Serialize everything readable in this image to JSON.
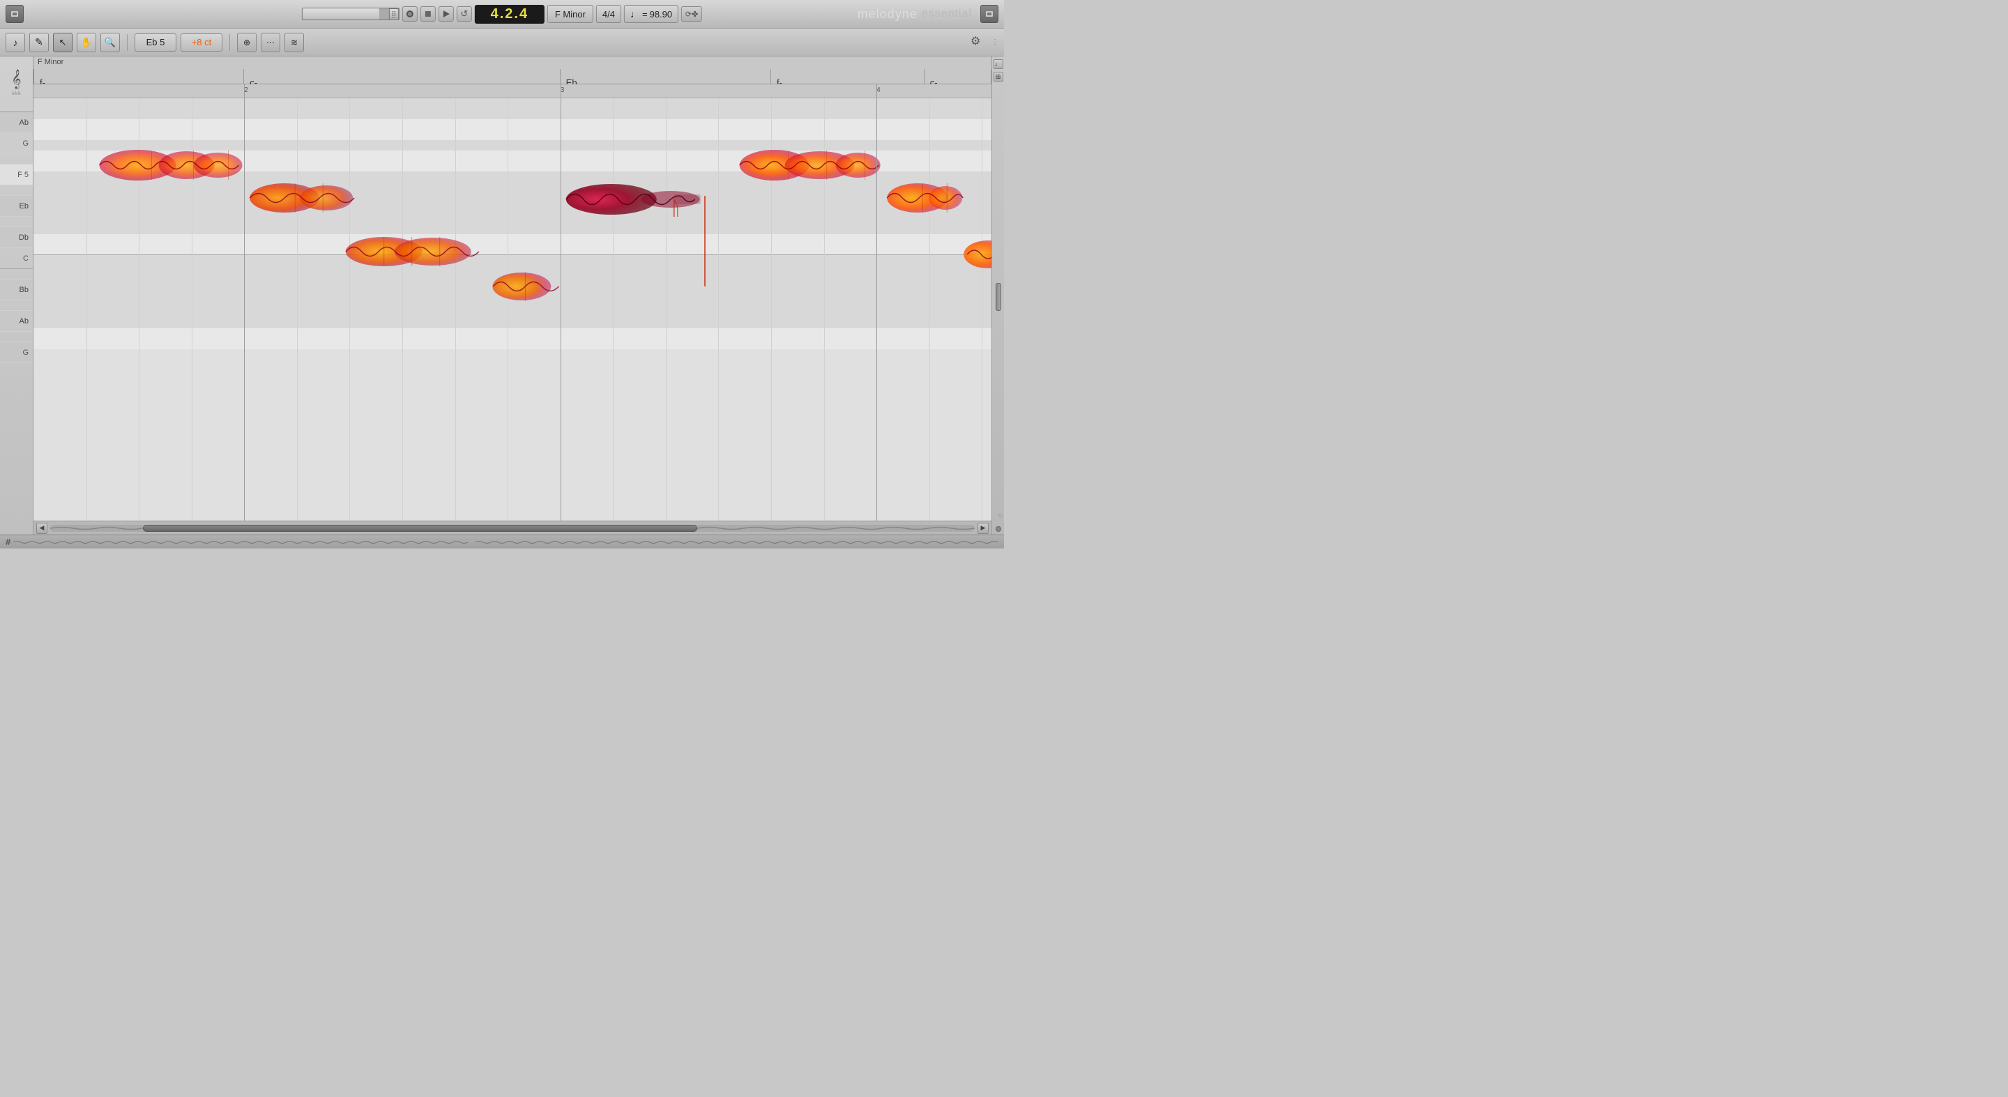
{
  "topbar": {
    "position": "4.2.4",
    "key": "F Minor",
    "time_signature": "4/4",
    "tempo_value": "98.90",
    "branding_main": "melodyne",
    "branding_sub": "essential",
    "transport": {
      "record_label": "●",
      "stop_label": "■",
      "play_label": "▶",
      "loop_label": "↺"
    }
  },
  "toolbar": {
    "pitch_note": "Eb 5",
    "pitch_cents": "+8 ct"
  },
  "chord_header": {
    "key_label": "F Minor",
    "chords": [
      "f-",
      "c-",
      "Eb",
      "f-",
      "c-"
    ]
  },
  "timeline": {
    "markers": [
      "2",
      "3",
      "4"
    ]
  },
  "piano_keys": [
    {
      "note": "Ab",
      "type": "black"
    },
    {
      "note": "",
      "type": "white"
    },
    {
      "note": "G",
      "type": "white"
    },
    {
      "note": "",
      "type": "white"
    },
    {
      "note": "F 5",
      "type": "white"
    },
    {
      "note": "",
      "type": "white"
    },
    {
      "note": "Eb",
      "type": "black"
    },
    {
      "note": "",
      "type": "white"
    },
    {
      "note": "Db",
      "type": "black"
    },
    {
      "note": "C",
      "type": "white"
    },
    {
      "note": "",
      "type": "white"
    },
    {
      "note": "Bb",
      "type": "black"
    },
    {
      "note": "",
      "type": "white"
    },
    {
      "note": "Ab",
      "type": "black"
    },
    {
      "note": "",
      "type": "white"
    },
    {
      "note": "G",
      "type": "white"
    }
  ],
  "notes": [
    {
      "id": "n1",
      "label": "F5 blob 1",
      "color_start": "#ff8800",
      "color_end": "#cc0044"
    },
    {
      "id": "n2",
      "label": "Eb blob",
      "color_start": "#ff6600",
      "color_end": "#cc0033"
    },
    {
      "id": "n3",
      "label": "C blob",
      "color_start": "#ff8800",
      "color_end": "#bb0033"
    },
    {
      "id": "n4",
      "label": "Bb blob",
      "color_start": "#ff9900",
      "color_end": "#cc0044"
    },
    {
      "id": "n5",
      "label": "Eb long",
      "color_start": "#cc0033",
      "color_end": "#990022"
    },
    {
      "id": "n6",
      "label": "F5 blob 2",
      "color_start": "#ff8800",
      "color_end": "#cc0044"
    },
    {
      "id": "n7",
      "label": "Eb right",
      "color_start": "#ff8800",
      "color_end": "#cc0033"
    }
  ],
  "scrollbar": {
    "thumb_position": "10%",
    "thumb_width": "60%"
  }
}
